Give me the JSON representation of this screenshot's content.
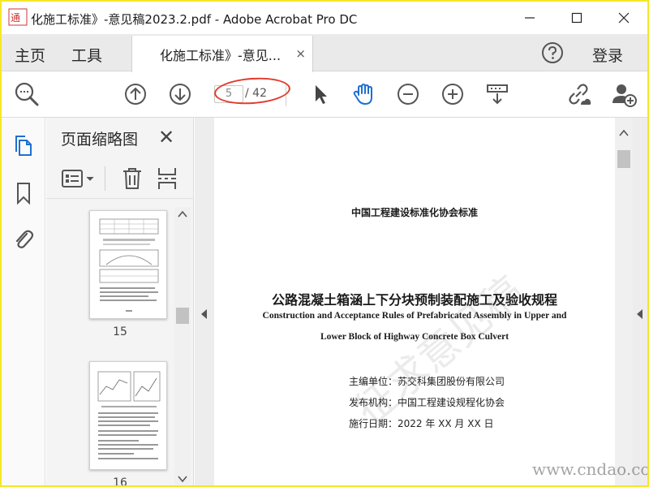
{
  "window": {
    "title": "化施工标准》-意见稿2023.2.pdf - Adobe Acrobat Pro DC",
    "logo_text": "通标准"
  },
  "tabs": {
    "home": "主页",
    "tools": "工具",
    "document": "化施工标准》-意见...",
    "close_symbol": "×",
    "login": "登录"
  },
  "toolbar": {
    "current_page": "5",
    "total_pages": "/ 42"
  },
  "thumbnail_panel": {
    "title": "页面缩略图",
    "close_symbol": "✕",
    "pages": [
      {
        "number": "15"
      },
      {
        "number": "16"
      }
    ]
  },
  "document": {
    "org": "中国工程建设标准化协会标准",
    "title_cn": "公路混凝土箱涵上下分块预制装配施工及验收规程",
    "title_en_line1": "Construction and Acceptance Rules of Prefabricated Assembly in Upper and",
    "title_en_line2": "Lower Block of Highway Concrete Box Culvert",
    "editor": "主编单位：苏交科集团股份有限公司",
    "publisher": "发布机构：中国工程建设规程化协会",
    "date": "施行日期：2022 年 XX 月 XX 日",
    "watermark": "征求意见稿"
  },
  "site_watermark": "www.cndao.com",
  "colors": {
    "accent_blue": "#1f6fd1",
    "highlight_red": "#e23a2c",
    "frame_yellow": "#f5e62a"
  }
}
